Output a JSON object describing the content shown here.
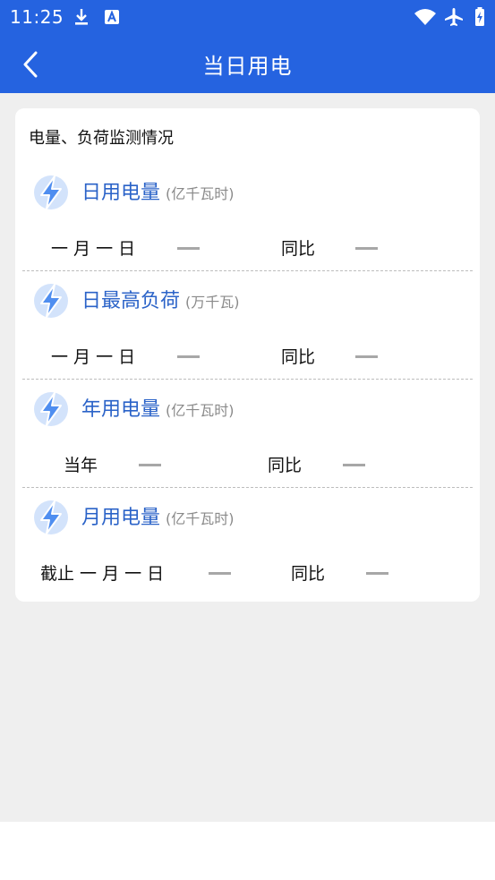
{
  "status_bar": {
    "time": "11:25",
    "left_icons": [
      "download-icon",
      "font-a-icon"
    ],
    "right_icons": [
      "wifi-icon",
      "airplane-icon",
      "battery-charging-icon"
    ]
  },
  "app_bar": {
    "back_icon": "chevron-left-icon",
    "title": "当日用电"
  },
  "colors": {
    "primary": "#2563e0",
    "metric_text": "#2b63c8",
    "background": "#efefef",
    "card": "#ffffff",
    "dash": "#a7a7a7",
    "bolt_circle": "#d3e3fb",
    "bolt_fill": "#4f8ef0"
  },
  "card": {
    "title": "电量、负荷监测情况",
    "sections": [
      {
        "icon": "lightning-bolt-icon",
        "name": "日用电量",
        "unit": "(亿千瓦时)",
        "period_label": "一 月 一 日",
        "value": "—",
        "yoy_label": "同比",
        "yoy_value": "—"
      },
      {
        "icon": "lightning-bolt-icon",
        "name": "日最高负荷",
        "unit": "(万千瓦)",
        "period_label": "一 月 一 日",
        "value": "—",
        "yoy_label": "同比",
        "yoy_value": "—"
      },
      {
        "icon": "lightning-bolt-icon",
        "name": "年用电量",
        "unit": "(亿千瓦时)",
        "period_label": "当年",
        "value": "—",
        "yoy_label": "同比",
        "yoy_value": "—"
      },
      {
        "icon": "lightning-bolt-icon",
        "name": "月用电量",
        "unit": "(亿千瓦时)",
        "period_label": "截止 一 月 一 日",
        "value": "—",
        "yoy_label": "同比",
        "yoy_value": "—"
      }
    ]
  }
}
